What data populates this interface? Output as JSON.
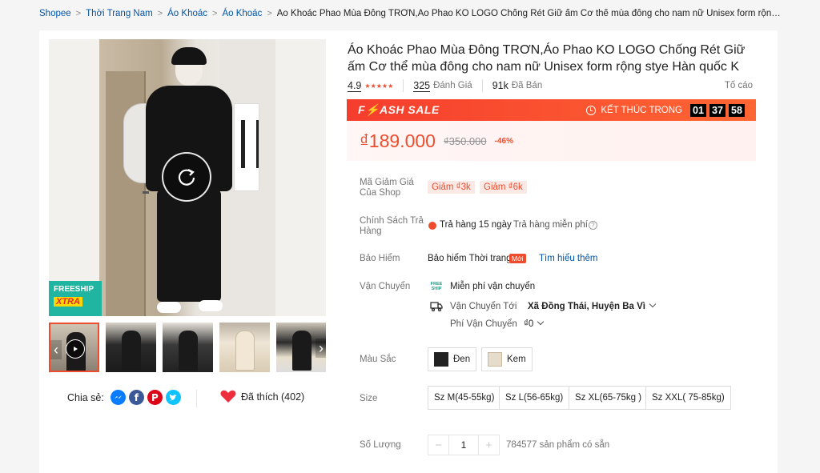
{
  "breadcrumb": {
    "items": [
      "Shopee",
      "Thời Trang Nam",
      "Áo Khoác",
      "Áo Khoác"
    ],
    "current": "Áo Khoác Phao Mùa Đông TRƠN,Áo Phao KO LOGO Chống Rét Giữ ấm Cơ thể mùa đông cho nam nữ Unisex form rộng stye Hàn quố..."
  },
  "gallery": {
    "badge_top": "FREESHIP",
    "badge_bottom": "XTRA",
    "thumbnails": 5
  },
  "share": {
    "label": "Chia sẻ:",
    "networks": [
      "messenger-icon",
      "facebook-icon",
      "pinterest-icon",
      "twitter-icon"
    ]
  },
  "like": {
    "label": "Đã thích (402)"
  },
  "product": {
    "title": "Áo Khoác Phao Mùa Đông TRƠN,Áo Phao KO LOGO Chống Rét Giữ ấm Cơ thể mùa đông cho nam nữ Unisex form rộng stye Hàn quốc K",
    "rating": "4.9",
    "ratings_count": "325",
    "ratings_label": "Đánh Giá",
    "sold_count": "91k",
    "sold_label": "Đã Bán",
    "report": "Tố cáo"
  },
  "flash_sale": {
    "title": "F⚡ASH SALE",
    "ends_label": "KẾT THÚC TRONG",
    "hours": "01",
    "minutes": "37",
    "seconds": "58"
  },
  "price": {
    "current": "₫189.000",
    "original": "₫350.000",
    "discount": "-46%"
  },
  "shop_vouchers": {
    "label": "Mã Giảm Giá Của Shop",
    "items": [
      "Giảm ₫3k",
      "Giảm ₫6k"
    ]
  },
  "return_policy": {
    "label": "Chính Sách Trả Hàng",
    "days": "Trả hàng 15 ngày",
    "free": "Trả hàng miễn phí"
  },
  "insurance": {
    "label": "Bảo Hiểm",
    "name": "Bảo hiểm Thời trang",
    "badge": "Mới",
    "link": "Tìm hiểu thêm"
  },
  "shipping": {
    "label": "Vận Chuyển",
    "free_label": "Miễn phí vận chuyển",
    "to_label": "Vận Chuyển Tới",
    "destination": "Xã Đồng Thái, Huyện Ba Vì",
    "fee_label": "Phí Vận Chuyển",
    "fee": "₫0",
    "freeship_icon_text": "FREE SHIP"
  },
  "colors": {
    "label": "Màu Sắc",
    "options": [
      "Đen",
      "Kem"
    ]
  },
  "sizes": {
    "label": "Size",
    "options": [
      "Sz M(45-55kg)",
      "Sz L(56-65kg)",
      "Sz XL(65-75kg )",
      "Sz XXL( 75-85kg)"
    ]
  },
  "quantity": {
    "label": "Số Lượng",
    "value": "1",
    "minus": "−",
    "plus": "+",
    "stock": "784577 sản phẩm có sẵn"
  }
}
